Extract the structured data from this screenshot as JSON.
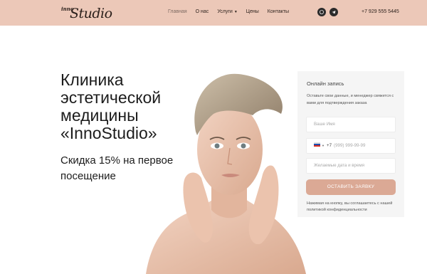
{
  "brand": {
    "logo_small": "inno",
    "logo_big": "Studio"
  },
  "nav": {
    "items": [
      {
        "label": "Главная"
      },
      {
        "label": "О нас"
      },
      {
        "label": "Услуги"
      },
      {
        "label": "Цены"
      },
      {
        "label": "Контакты"
      }
    ]
  },
  "header": {
    "social_icons": [
      "whatsapp-icon",
      "telegram-icon"
    ],
    "phone": "+7 929 555 5445"
  },
  "hero": {
    "title": "Клиника эстетической медицины «InnoStudio»",
    "subtitle": "Скидка 15% на первое посещение"
  },
  "form": {
    "title": "Онлайн запись",
    "description": "Оставьте свои данные, и менеджер свяжется с вами для подтверждения заказа",
    "name_placeholder": "Ваше Имя",
    "phone_code": "+7",
    "phone_placeholder": "(999) 999-99-99",
    "date_placeholder": "Желаемые дата и время",
    "submit_label": "ОСТАВИТЬ ЗАЯВКУ",
    "consent": "Нажимая на кнопку, вы соглашаетесь с нашей политикой конфиденциальности"
  },
  "colors": {
    "header_bg": "#ecc8b8",
    "accent_button": "#dba995",
    "form_bg": "#f5f5f5",
    "text_dark": "#1c1c1c"
  }
}
